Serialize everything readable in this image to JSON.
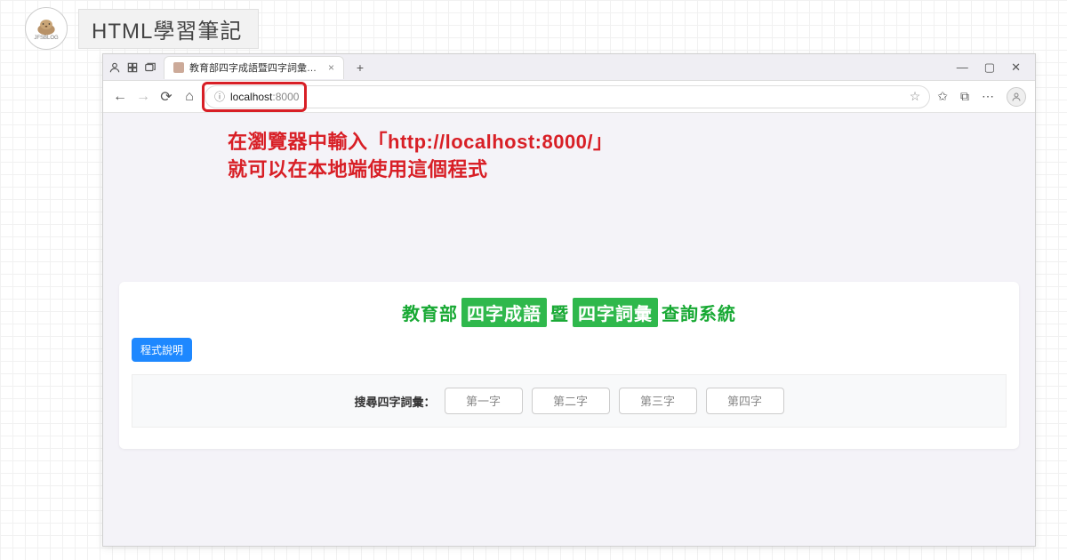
{
  "header": {
    "logo_caption": "JFSBLOG",
    "title": "HTML學習筆記"
  },
  "browser": {
    "tab_title": "教育部四字成語暨四字詞彙查詢系統",
    "url_host": "localhost",
    "url_port": ":8000",
    "nav": {
      "back": "←",
      "forward": "→",
      "reload": "⟳",
      "home": "⌂",
      "star": "☆",
      "fav": "✩",
      "collections": "⧉",
      "more": "⋯"
    },
    "window": {
      "min": "—",
      "max": "▢",
      "close": "✕"
    },
    "newtab": "+",
    "tab_close": "×"
  },
  "annotation": {
    "line1": "在瀏覽器中輸入「http://localhost:8000/」",
    "line2": "就可以在本地端使用這個程式"
  },
  "app": {
    "title_parts": {
      "p1": "教育部",
      "p2": "四字成語",
      "p3": "暨",
      "p4": "四字詞彙",
      "p5": "查詢系統"
    },
    "help_button": "程式說明",
    "search_label": "搜尋四字詞彙：",
    "inputs": {
      "c1": "第一字",
      "c2": "第二字",
      "c3": "第三字",
      "c4": "第四字"
    }
  }
}
